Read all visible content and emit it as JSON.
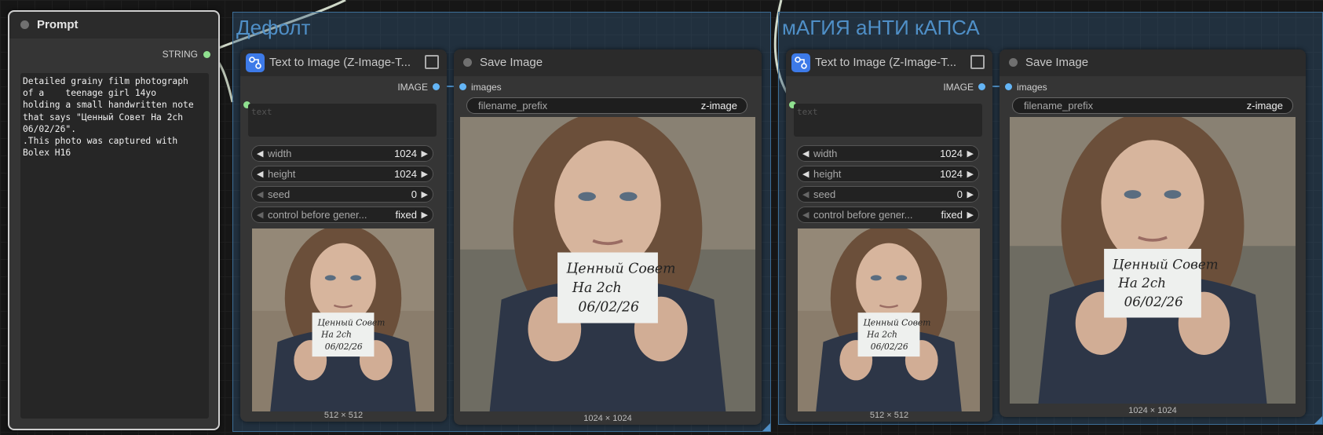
{
  "groups": [
    {
      "title": "Дефолт"
    },
    {
      "title": "мАГИЯ аНТИ кАПСА"
    }
  ],
  "prompt_node": {
    "title": "Prompt",
    "output_label": "STRING",
    "text": "Detailed grainy film photograph\nof a    teenage girl 14yo\nholding a small handwritten note\nthat says \"Ценный Совет На 2ch\n06/02/26\".\n.This photo was captured with\nBolex H16"
  },
  "t2i_nodes": [
    {
      "title": "Text to Image (Z-Image-T...",
      "output_label": "IMAGE",
      "text_placeholder": "text",
      "widgets": [
        {
          "label": "width",
          "value": "1024"
        },
        {
          "label": "height",
          "value": "1024"
        },
        {
          "label": "seed",
          "value": "0"
        },
        {
          "label": "control before gener...",
          "value": "fixed"
        }
      ],
      "preview_size": "512 × 512"
    },
    {
      "title": "Text to Image (Z-Image-T...",
      "output_label": "IMAGE",
      "text_placeholder": "text",
      "widgets": [
        {
          "label": "width",
          "value": "1024"
        },
        {
          "label": "height",
          "value": "1024"
        },
        {
          "label": "seed",
          "value": "0"
        },
        {
          "label": "control before gener...",
          "value": "fixed"
        }
      ],
      "preview_size": "512 × 512"
    }
  ],
  "save_nodes": [
    {
      "title": "Save Image",
      "input_label": "images",
      "filename_prefix_label": "filename_prefix",
      "filename_prefix_value": "z-image",
      "preview_size": "1024 × 1024"
    },
    {
      "title": "Save Image",
      "input_label": "images",
      "filename_prefix_label": "filename_prefix",
      "filename_prefix_value": "z-image",
      "preview_size": "1024 × 1024"
    }
  ],
  "note_text": {
    "line1": "Ценный Совет",
    "line2": "На 2ch",
    "line3": "06/02/26"
  },
  "colors": {
    "string_port": "#8fe08f",
    "image_port": "#64b5f6",
    "group_fill": "#345c80",
    "group_title": "#4f8fc7",
    "badge": "#3d7ae8"
  },
  "icons": [
    "node-status-dot",
    "workflow-badge-icon",
    "expand-icon",
    "left-arrow-icon",
    "right-arrow-icon"
  ]
}
